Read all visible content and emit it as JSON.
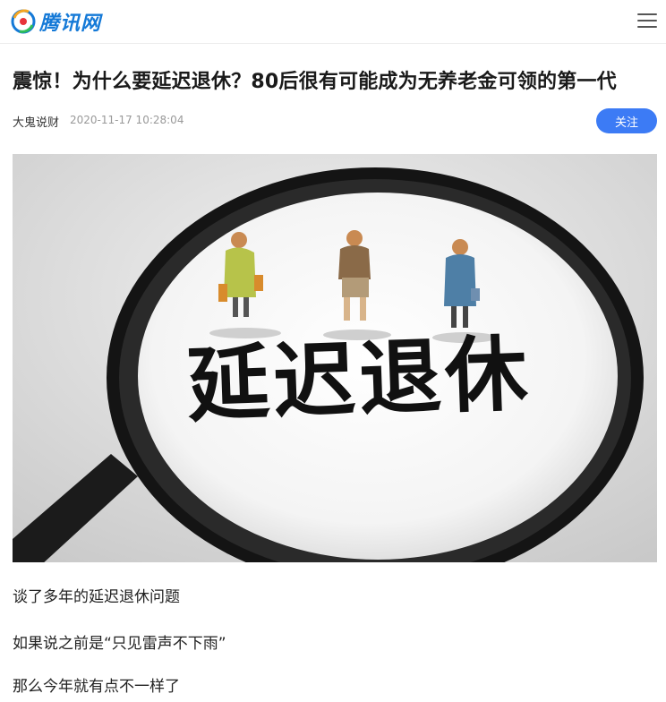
{
  "header": {
    "logo_text": "腾讯网",
    "logo_icon": "tencent-news-logo-icon",
    "menu_icon": "hamburger-menu-icon"
  },
  "article": {
    "title": "震惊！为什么要延迟退休？80后很有可能成为无养老金可领的第一代",
    "author": "大鬼说财",
    "timestamp": "2020-11-17 10:28:04",
    "follow_label": "关注",
    "image": {
      "caption_text": "延迟退休"
    },
    "paragraphs": [
      "谈了多年的延迟退休问题",
      "如果说之前是“只见雷声不下雨”",
      "那么今年就有点不一样了"
    ]
  },
  "colors": {
    "brand_blue": "#1479d7",
    "follow_button": "#3c7bf5",
    "title_text": "#1a1a1a",
    "meta_text": "#999999"
  }
}
